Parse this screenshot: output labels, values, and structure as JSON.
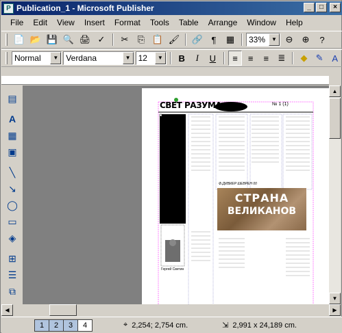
{
  "window": {
    "title": "Publication_1 - Microsoft Publisher",
    "icon": "publisher-app-icon",
    "controls": {
      "minimize": "_",
      "maximize": "□",
      "close": "×"
    }
  },
  "menu": [
    "File",
    "Edit",
    "View",
    "Insert",
    "Format",
    "Tools",
    "Table",
    "Arrange",
    "Window",
    "Help"
  ],
  "standard_toolbar": {
    "zoom_value": "33%"
  },
  "format_toolbar": {
    "style_value": "Normal",
    "font_value": "Verdana",
    "size_value": "12"
  },
  "document": {
    "masthead_title": "СВЕТ РАЗУМА",
    "issue": "№ 1 (1)",
    "banner_line1": "СТРАНА",
    "banner_line2": "ВЕЛИКАНОВ",
    "caption_small": "Ф.ДИВИЕР ШЕВРЕН 00",
    "body_snippet": "Гергей Светин"
  },
  "status": {
    "pages": [
      "1",
      "2",
      "3",
      "4"
    ],
    "active_page": "4",
    "position": "2,254; 2,754 cm.",
    "size": "2,991 x 24,189 cm."
  },
  "colors": {
    "title_gradient_start": "#0a246a",
    "title_gradient_end": "#3a6ea5",
    "chrome": "#d4d0c8",
    "workspace": "#808080",
    "banner": "#8a6a4a"
  }
}
